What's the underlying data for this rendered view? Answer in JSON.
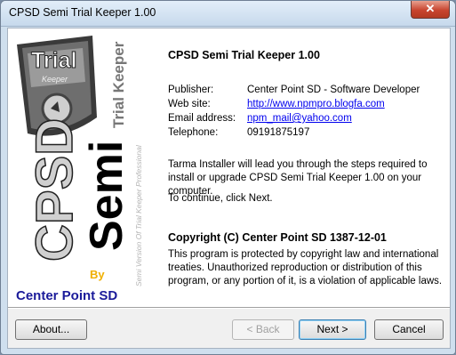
{
  "window": {
    "title": "CPSD Semi Trial Keeper 1.00",
    "close_glyph": "✕"
  },
  "sidebar": {
    "logo_word": "Trial",
    "logo_sub": "Keeper",
    "product_line1": "Trial Keeper",
    "product_line2": "Semi Version Of Trial Keeper Professional",
    "cpsd": "CPSD",
    "semi": "Semi",
    "by": "By",
    "company": "Center Point SD",
    "colors": {
      "cpsd": "#d0d0d0",
      "semi": "#000000",
      "by": "#f0b000",
      "company": "#1b1b9a"
    }
  },
  "main": {
    "heading": "CPSD Semi Trial Keeper 1.00",
    "info": [
      {
        "label": "Publisher:",
        "value": "Center Point SD - Software Developer",
        "link": false
      },
      {
        "label": "Web site:",
        "value": "http://www.npmpro.blogfa.com",
        "link": true
      },
      {
        "label": "Email address:",
        "value": "npm_mail@yahoo.com",
        "link": true
      },
      {
        "label": "Telephone:",
        "value": "09191875197",
        "link": false
      }
    ],
    "install_text": "Tarma Installer will lead you through the steps required to install or upgrade CPSD Semi Trial Keeper 1.00 on your computer.",
    "continue_text": "To continue, click Next.",
    "copyright_heading": "Copyright (C)  Center Point SD 1387-12-01",
    "copyright_text": "This program is protected by copyright law and international treaties. Unauthorized reproduction or distribution of this program, or any portion of it, is a violation of applicable laws."
  },
  "buttons": {
    "about": "About...",
    "back": "< Back",
    "next": "Next >",
    "cancel": "Cancel"
  }
}
